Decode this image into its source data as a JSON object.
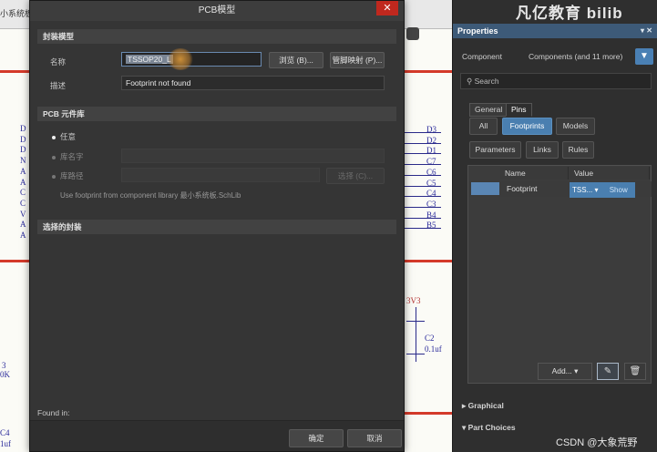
{
  "schematic": {
    "tab_text": "小系统板",
    "pins_left": [
      "D",
      "D",
      "D",
      "N",
      "A",
      "A",
      "C",
      "C",
      "V",
      "A",
      "A"
    ],
    "pins_right": [
      "D3",
      "D2",
      "D1",
      "C7",
      "C6",
      "C5",
      "C4",
      "C3",
      "B4",
      "B5"
    ],
    "net_3v3": "3V3",
    "cap_label": "C2",
    "cap_value": "0.1uf",
    "left_text_1": "3",
    "left_text_2": "0K",
    "left_text_3": "C4",
    "left_text_4": "1uf"
  },
  "dialog": {
    "title": "PCB模型",
    "close_glyph": "✕",
    "section_model": "封装模型",
    "name_label": "名称",
    "name_value": "TSSOP20_L",
    "browse_button": "浏览 (B)...",
    "pin_map_button": "管脚映射 (P)...",
    "desc_label": "描述",
    "desc_value": "Footprint not found",
    "section_library": "PCB 元件库",
    "radio_any": "任意",
    "radio_libname": "库名字",
    "radio_libpath": "库路径",
    "choose_button": "选择 (C)...",
    "hint": "Use footprint from component library 最小系统板.SchLib",
    "section_selected": "选择的封装",
    "found_in": "Found in:",
    "ok_button": "确定",
    "cancel_button": "取消"
  },
  "properties": {
    "brand": "凡亿教育 bilib",
    "title": "Properties",
    "pin_glyph": "▾ ✕",
    "component_label": "Component",
    "component_value": "Components (and 11 more)",
    "search_placeholder": "Search",
    "tabs": [
      "General",
      "Pins"
    ],
    "filter_buttons": [
      "All",
      "Footprints",
      "Models"
    ],
    "sub_buttons": [
      "Parameters",
      "Links",
      "Rules"
    ],
    "columns": [
      "Name",
      "Value"
    ],
    "row": {
      "name": "Footprint",
      "value": "TSS...",
      "show": "Show"
    },
    "add_button": "Add...",
    "graphical": "Graphical",
    "part_choices": "Part Choices",
    "watermark": "CSDN @大象荒野"
  }
}
